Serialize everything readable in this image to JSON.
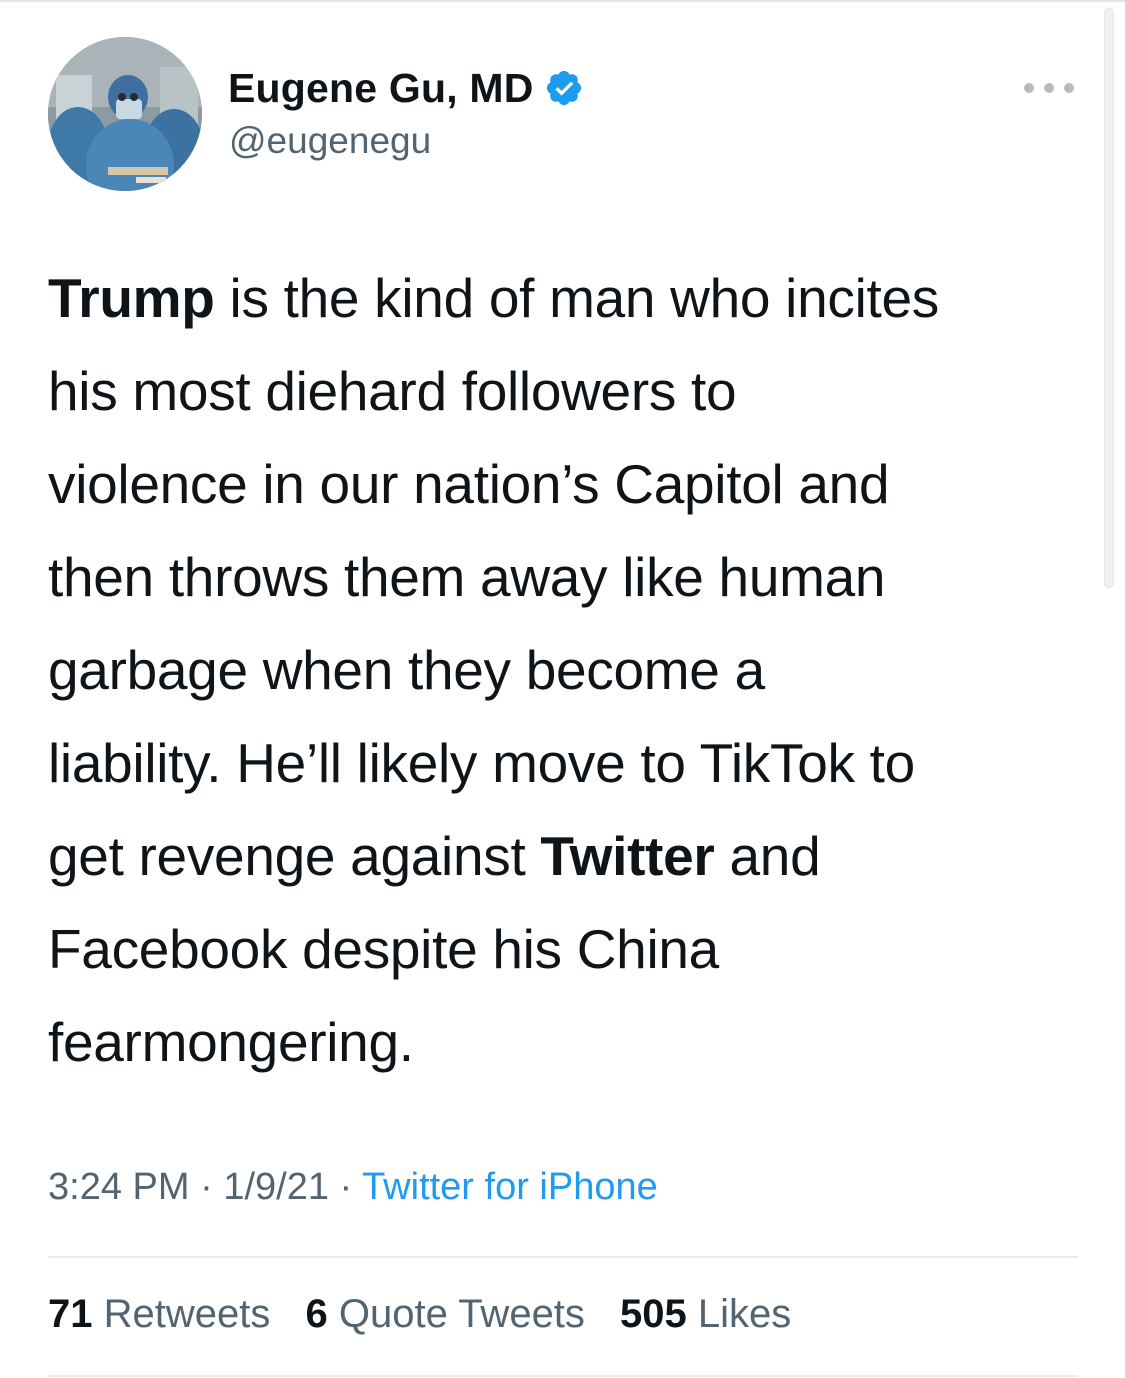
{
  "author": {
    "name": "Eugene Gu, MD",
    "handle": "@eugenegu",
    "verified": true,
    "avatar_icon": "surgeon-photo-avatar"
  },
  "more_icon": "more-dots-icon",
  "tweet": {
    "lines": [
      [
        {
          "text": "Trump",
          "bold": true
        },
        {
          "text": " is the kind of man who incites",
          "bold": false
        }
      ],
      [
        {
          "text": "his most diehard followers to",
          "bold": false
        }
      ],
      [
        {
          "text": "violence in our nation’s Capitol and",
          "bold": false
        }
      ],
      [
        {
          "text": "then throws them away like human",
          "bold": false
        }
      ],
      [
        {
          "text": "garbage when they become a",
          "bold": false
        }
      ],
      [
        {
          "text": "liability. He’ll likely move to TikTok to",
          "bold": false
        }
      ],
      [
        {
          "text": "get revenge against ",
          "bold": false
        },
        {
          "text": "Twitter",
          "bold": true
        },
        {
          "text": " and",
          "bold": false
        }
      ],
      [
        {
          "text": "Facebook despite his China",
          "bold": false
        }
      ],
      [
        {
          "text": "fearmongering.",
          "bold": false
        }
      ]
    ]
  },
  "meta": {
    "time": "3:24 PM",
    "separator": " · ",
    "date": "1/9/21",
    "source": "Twitter for iPhone"
  },
  "stats": {
    "retweets_count": "71",
    "retweets_label": " Retweets",
    "quotes_count": "6",
    "quotes_label": " Quote Tweets",
    "likes_count": "505",
    "likes_label": " Likes"
  },
  "colors": {
    "verified": "#1d9bf0",
    "link": "#1d9bf0",
    "secondary_text": "#536471"
  }
}
